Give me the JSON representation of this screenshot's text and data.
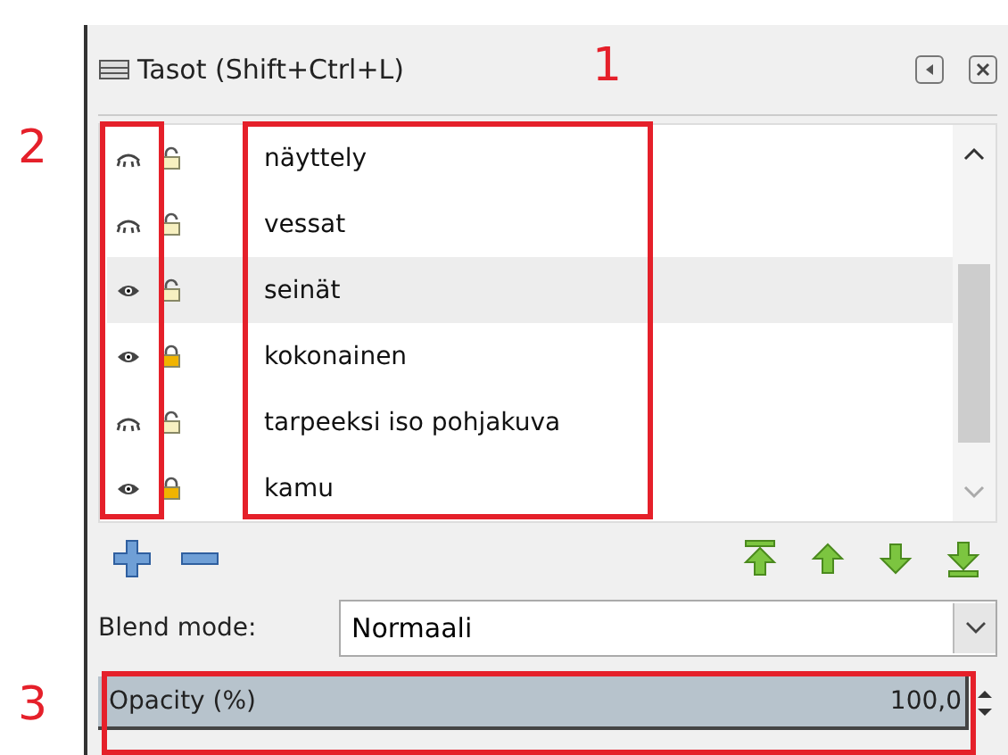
{
  "panel": {
    "title": "Tasot (Shift+Ctrl+L)"
  },
  "layers": [
    {
      "name": "näyttely",
      "visible": false,
      "locked": false,
      "selected": false
    },
    {
      "name": "vessat",
      "visible": false,
      "locked": false,
      "selected": false
    },
    {
      "name": "seinät",
      "visible": true,
      "locked": false,
      "selected": true
    },
    {
      "name": "kokonainen",
      "visible": true,
      "locked": true,
      "selected": false
    },
    {
      "name": "tarpeeksi iso pohjakuva",
      "visible": false,
      "locked": false,
      "selected": false
    },
    {
      "name": "kamu",
      "visible": true,
      "locked": true,
      "selected": false
    }
  ],
  "blend_mode": {
    "label": "Blend mode:",
    "value": "Normaali"
  },
  "opacity": {
    "label": "Opacity (%)",
    "reading": "100,0",
    "level": 1
  },
  "annotations": [
    {
      "number": "1"
    },
    {
      "number": "2"
    },
    {
      "number": "3"
    }
  ]
}
